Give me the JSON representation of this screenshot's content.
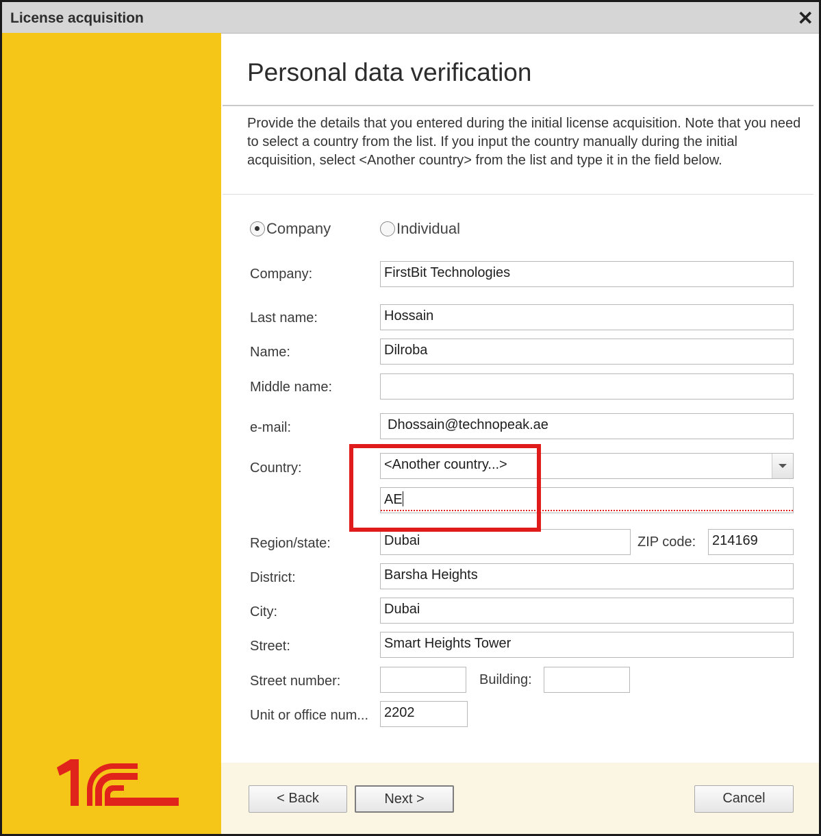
{
  "window": {
    "title": "License acquisition",
    "close_glyph": "✕"
  },
  "page": {
    "heading": "Personal data verification",
    "description": "Provide the details that you entered during the initial license acquisition. Note that you need to select a country from the list. If you input the country manually during the initial acquisition, select <Another country> from the list and type it in the field below."
  },
  "entity_type": {
    "options": [
      "Company",
      "Individual"
    ],
    "selected": "Company"
  },
  "form": {
    "company": {
      "label": "Company:",
      "value": "FirstBit Technologies"
    },
    "last_name": {
      "label": "Last name:",
      "value": "Hossain"
    },
    "name": {
      "label": "Name:",
      "value": "Dilroba"
    },
    "middle_name": {
      "label": "Middle name:",
      "value": ""
    },
    "email": {
      "label": "e-mail:",
      "value": "Dhossain@technopeak.ae"
    },
    "country": {
      "label": "Country:",
      "selected": "<Another country...>",
      "manual_value": "AE"
    },
    "region": {
      "label": "Region/state:",
      "value": "Dubai"
    },
    "zip": {
      "label": "ZIP code:",
      "value": "214169"
    },
    "district": {
      "label": "District:",
      "value": "Barsha Heights"
    },
    "city": {
      "label": "City:",
      "value": "Dubai"
    },
    "street": {
      "label": "Street:",
      "value": "Smart Heights Tower"
    },
    "street_number": {
      "label": "Street number:",
      "value": ""
    },
    "building": {
      "label": "Building:",
      "value": ""
    },
    "unit": {
      "label": "Unit or office num...",
      "value": "2202"
    }
  },
  "buttons": {
    "back": "< Back",
    "next": "Next >",
    "cancel": "Cancel"
  },
  "colors": {
    "sidebar": "#f5c518",
    "logo_red": "#e0231b",
    "highlight": "#e01b1b",
    "footer": "#fbf6e3"
  },
  "logo": {
    "text": "1C"
  }
}
